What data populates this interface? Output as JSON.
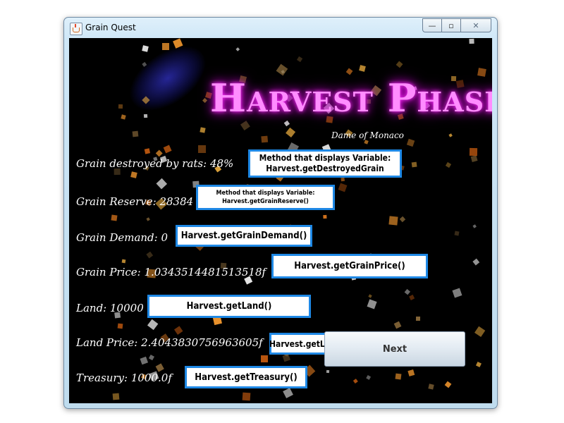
{
  "window": {
    "title": "Grain Quest"
  },
  "window_controls": {
    "minimize": "—",
    "maximize": "▫",
    "close": "✕"
  },
  "heading": "Harvest Phase",
  "subtitle": "Dame of Monaco",
  "stats": [
    {
      "label": "Grain destroyed by rats:",
      "value": "48%"
    },
    {
      "label": "Grain Reserve:",
      "value": "28384"
    },
    {
      "label": "Grain Demand:",
      "value": "0"
    },
    {
      "label": "Grain Price:",
      "value": "1.0343514481513518f"
    },
    {
      "label": "Land:",
      "value": "10000"
    },
    {
      "label": "Land Price:",
      "value": "2.4043830756963605f"
    },
    {
      "label": "Treasury:",
      "value": "1000.0f"
    }
  ],
  "methods": [
    {
      "line1": "Method that displays Variable:",
      "line2": "Harvest.getDestroyedGrain"
    },
    {
      "line1": "Method that displays Variable:",
      "line2": "Harvest.getGrainReserve()"
    },
    {
      "line1": "Harvest.getGrainDemand()"
    },
    {
      "line1": "Harvest.getGrainPrice()"
    },
    {
      "line1": "Harvest.getLand()"
    },
    {
      "line1": "Harvest.getLandPrice()"
    },
    {
      "line1": "Harvest.getTreasury()"
    }
  ],
  "next_button": {
    "label": "Next"
  },
  "colors": {
    "heading": "#ff8cff",
    "method_border": "#1e88e5",
    "background": "#000000"
  },
  "icons": {
    "app_icon": "java-cup-icon"
  }
}
